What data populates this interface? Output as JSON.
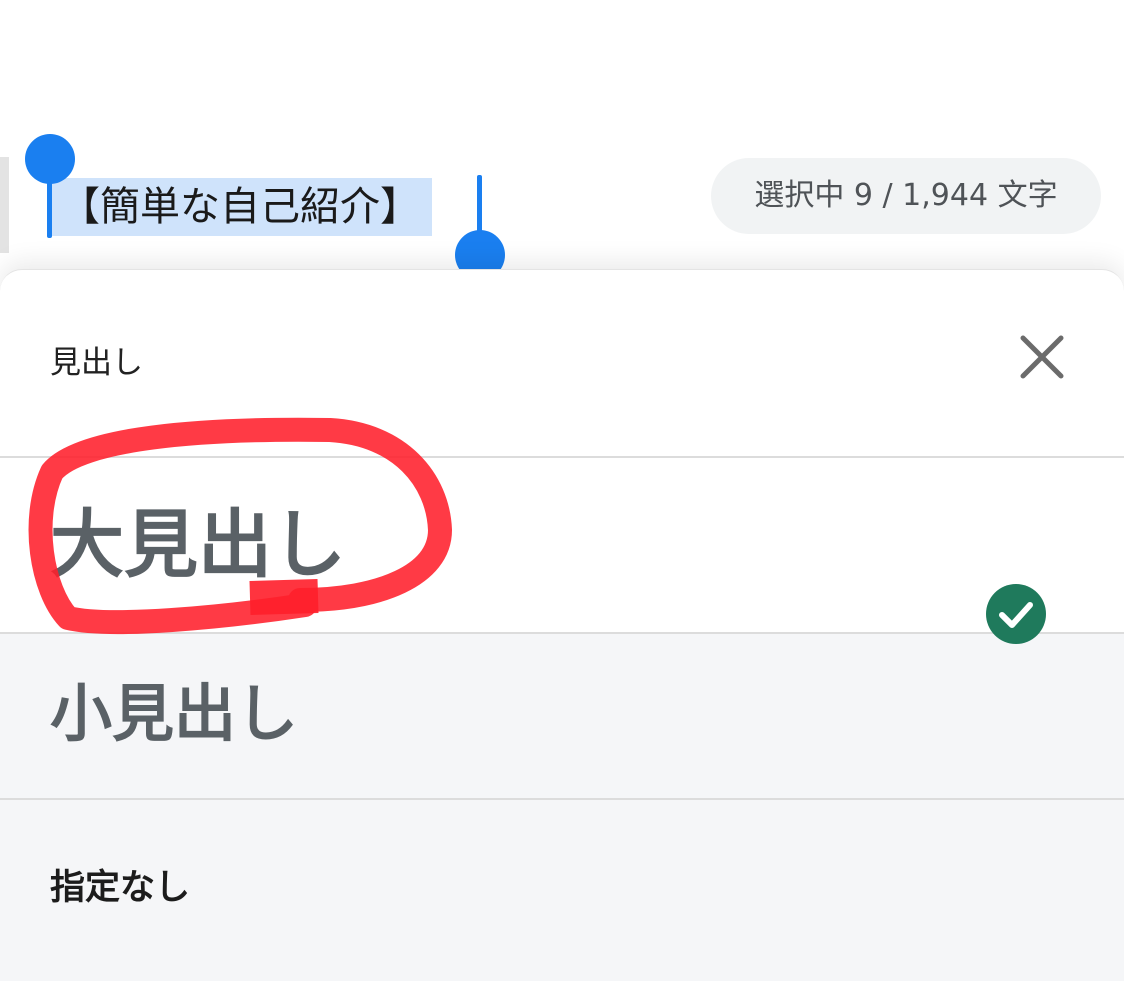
{
  "editor": {
    "selected_text": "【簡単な自己紹介】",
    "selection_count": "選択中 9 / 1,944 文字"
  },
  "sheet": {
    "title": "見出し",
    "options": [
      {
        "label": "大見出し",
        "selected": false,
        "highlighted": true
      },
      {
        "label": "小見出し",
        "selected": false,
        "highlighted": false
      },
      {
        "label": "指定なし",
        "selected": true,
        "highlighted": false
      }
    ]
  },
  "icons": {
    "close": "close-icon",
    "check": "check-circle-icon"
  },
  "colors": {
    "selection_handle": "#1a7ff0",
    "selection_bg": "#cfe3fb",
    "check": "#1f7a5c",
    "annotation": "#ff1f2b",
    "heading_text": "#5a6166"
  }
}
